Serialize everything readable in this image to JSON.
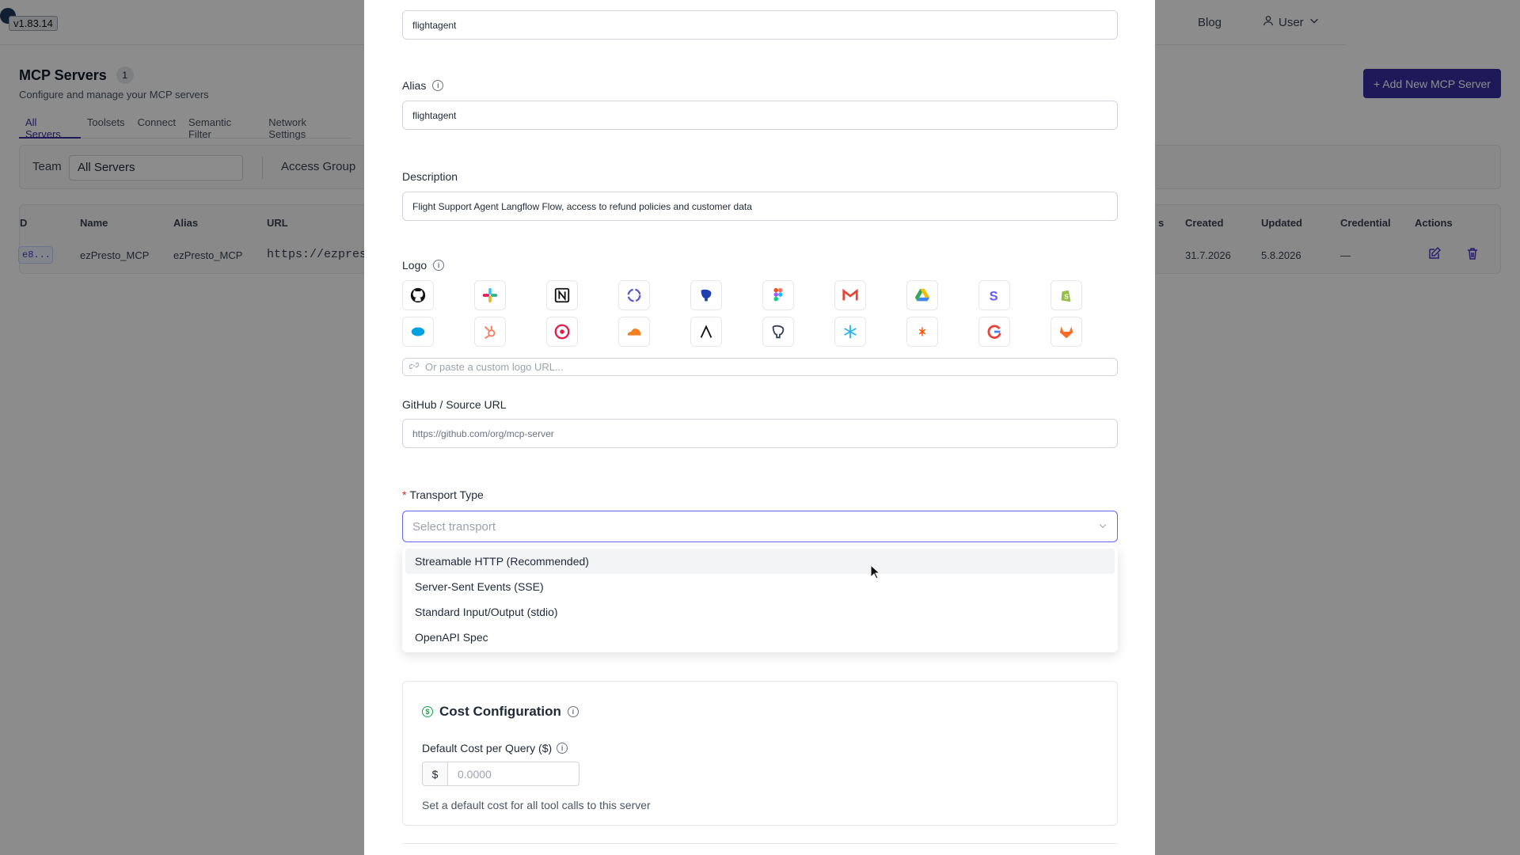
{
  "app": {
    "version": "v1.83.14"
  },
  "topnav": {
    "blog_label": "Blog",
    "user_label": "User"
  },
  "page": {
    "title": "MCP Servers",
    "count": "1",
    "subtitle": "Configure and manage your MCP servers",
    "add_button": "+ Add New MCP Server"
  },
  "tabs": [
    "All Servers",
    "Toolsets",
    "Connect",
    "Semantic Filter",
    "Network Settings"
  ],
  "filters": {
    "team_label": "Team",
    "team_value": "All Servers",
    "access_group_label": "Access Group"
  },
  "table": {
    "headers": {
      "id": "D",
      "name": "Name",
      "alias": "Alias",
      "url": "URL",
      "status": "s",
      "created": "Created",
      "updated": "Updated",
      "credential": "Credential",
      "actions": "Actions"
    },
    "row": {
      "id": "e8...",
      "name": "ezPresto_MCP",
      "alias": "ezPresto_MCP",
      "url": "https://ezprest",
      "created": "31.7.2026",
      "updated": "5.8.2026",
      "credential": "—"
    }
  },
  "modal": {
    "server_name_value": "flightagent",
    "alias_label": "Alias",
    "alias_value": "flightagent",
    "description_label": "Description",
    "description_value": "Flight Support Agent Langflow Flow, access to refund policies and customer data",
    "logo_label": "Logo",
    "logos": [
      "github-icon",
      "slack-icon",
      "notion-icon",
      "linear-icon",
      "postgres-icon",
      "figma-icon",
      "gmail-icon",
      "drive-icon",
      "stripe-icon",
      "shopify-icon",
      "salesforce-icon",
      "hubspot-icon",
      "todoist-icon",
      "cloudflare-icon",
      "arch-icon",
      "database-icon",
      "snowflake-icon",
      "zapier-icon",
      "google-icon",
      "gitlab-icon"
    ],
    "logo_url_placeholder": "Or paste a custom logo URL...",
    "source_label": "GitHub / Source URL",
    "source_placeholder": "https://github.com/org/mcp-server",
    "transport_label": "Transport Type",
    "transport_placeholder": "Select transport",
    "transport_options": [
      "Streamable HTTP (Recommended)",
      "Server-Sent Events (SSE)",
      "Standard Input/Output (stdio)",
      "OpenAPI Spec"
    ],
    "cost": {
      "title": "Cost Configuration",
      "default_label": "Default Cost per Query ($)",
      "prefix": "$",
      "placeholder": "0.0000",
      "help": "Set a default cost for all tool calls to this server"
    }
  },
  "colors": {
    "accent": "#3730a3",
    "focus": "#6366f1",
    "required": "#dc2626",
    "cost_icon": "#16a34a"
  }
}
